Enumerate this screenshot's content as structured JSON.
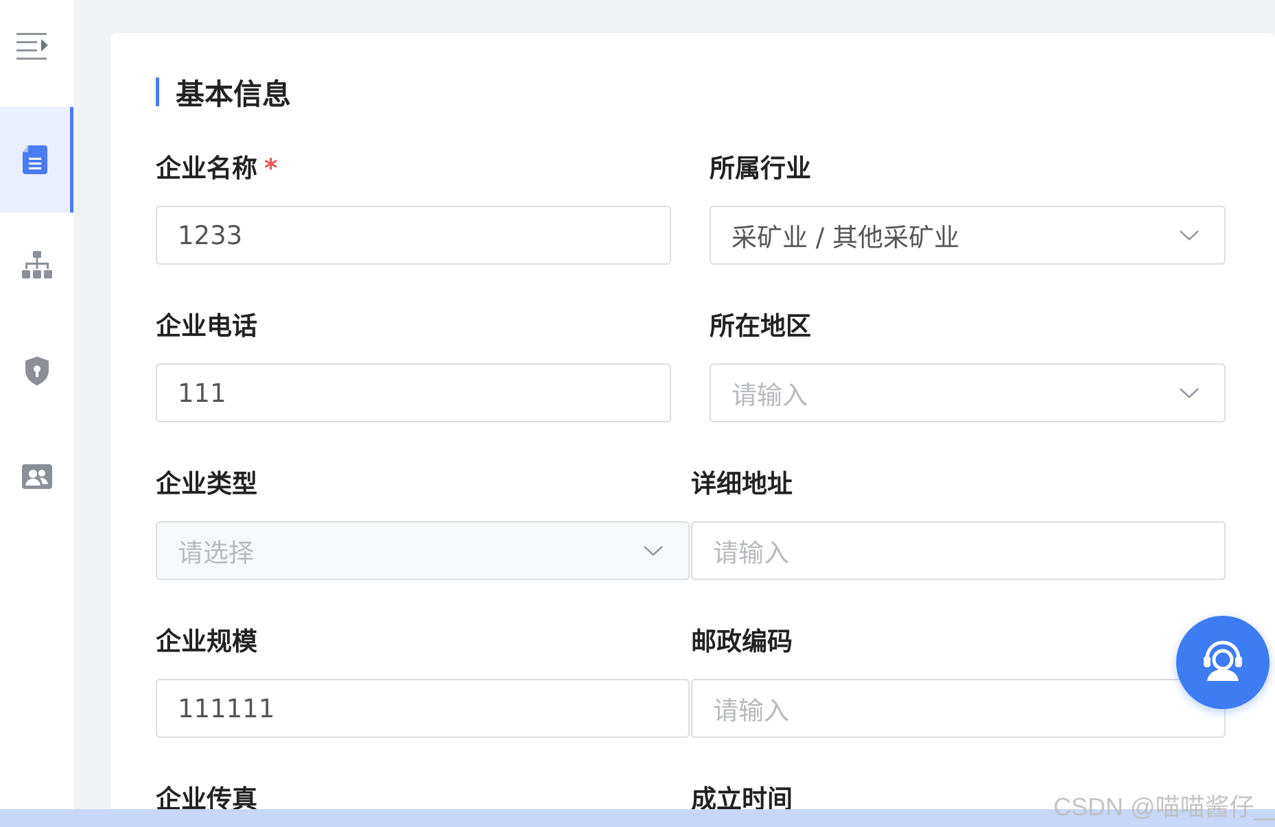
{
  "section": {
    "title": "基本信息"
  },
  "fields": {
    "company_name": {
      "label": "企业名称",
      "required_mark": "*",
      "value": "1233"
    },
    "industry": {
      "label": "所属行业",
      "value": "采矿业 / 其他采矿业"
    },
    "phone": {
      "label": "企业电话",
      "value": "111"
    },
    "region": {
      "label": "所在地区",
      "placeholder": "请输入"
    },
    "company_type": {
      "label": "企业类型",
      "placeholder": "请选择"
    },
    "address": {
      "label": "详细地址",
      "placeholder": "请输入"
    },
    "scale": {
      "label": "企业规模",
      "value": "111111"
    },
    "postcode": {
      "label": "邮政编码",
      "placeholder": "请输入"
    },
    "fax": {
      "label": "企业传真"
    },
    "founded": {
      "label": "成立时间"
    }
  },
  "watermark": "CSDN @喵喵酱仔__",
  "icons": {
    "menu_toggle": "menu-collapse-icon",
    "nav": [
      "document-icon",
      "org-chart-icon",
      "shield-icon",
      "contacts-icon"
    ],
    "fab": "customer-service-icon"
  },
  "colors": {
    "accent": "#4c7bf5",
    "required": "#e8574e",
    "fab": "#3d7cf2"
  }
}
